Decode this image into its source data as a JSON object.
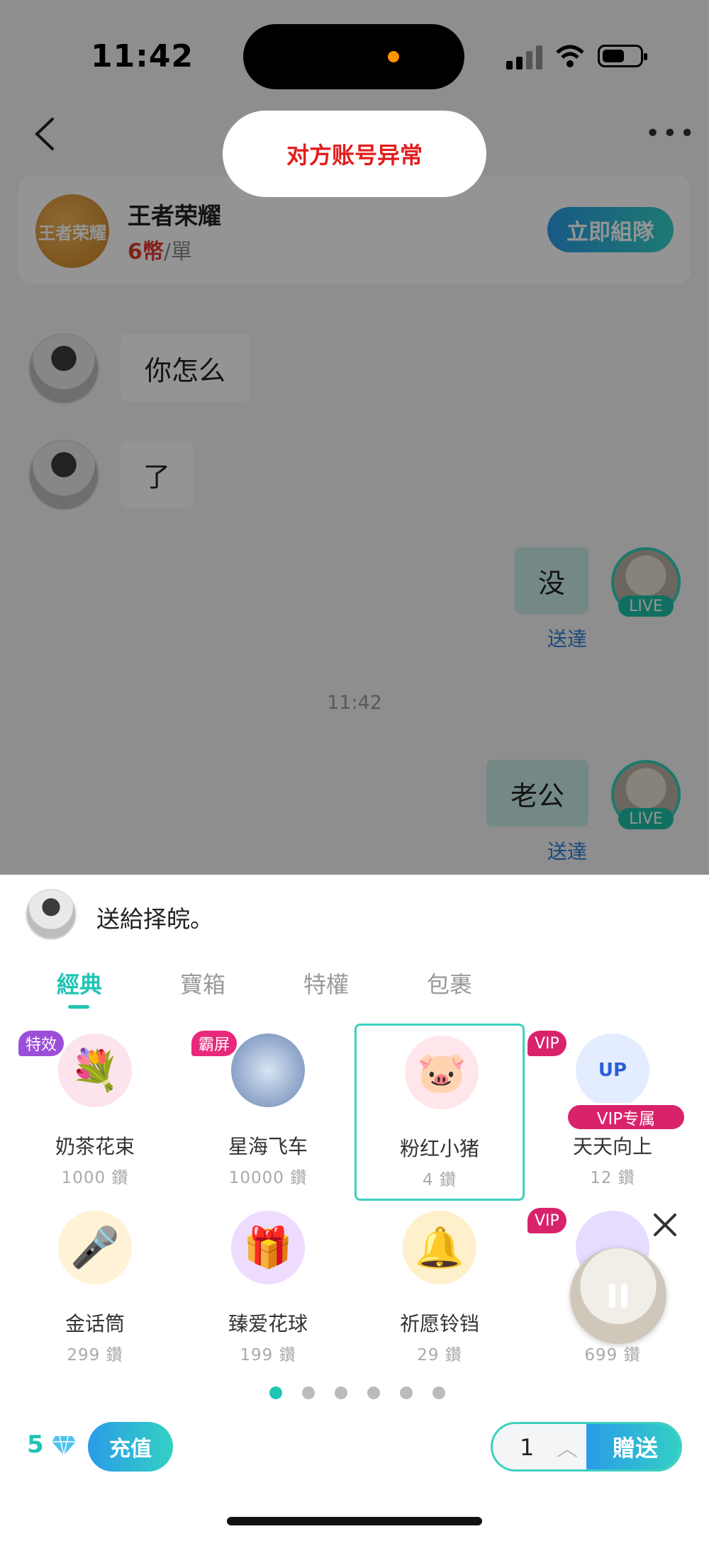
{
  "status_bar": {
    "time": "11:42"
  },
  "toast": {
    "text": "对方账号异常"
  },
  "game_card": {
    "logo_text": "王者荣耀",
    "title": "王者荣耀",
    "price_value": "6",
    "price_unit": "幣",
    "price_sep": "/",
    "price_per": "單",
    "team_button": "立即組隊"
  },
  "messages": [
    {
      "text": "你怎么",
      "from": "other"
    },
    {
      "text": "了",
      "from": "other"
    },
    {
      "text": "没",
      "from": "me",
      "status": "送達"
    },
    {
      "text": "老公",
      "from": "me",
      "status": "送達"
    }
  ],
  "chat_time": "11:42",
  "live_tag": "LIVE",
  "gift_panel": {
    "recipient_text": "送給择皖。",
    "tabs": [
      "經典",
      "寶箱",
      "特權",
      "包裹"
    ],
    "gifts": [
      {
        "name": "奶茶花束",
        "price": "1000 鑽",
        "badge": "特效"
      },
      {
        "name": "星海飞车",
        "price": "10000 鑽",
        "badge": "霸屏"
      },
      {
        "name": "粉红小猪",
        "price": "4 鑽",
        "badge": ""
      },
      {
        "name": "天天向上",
        "price": "12 鑽",
        "badge": "VIP",
        "vip_label": "VIP专属"
      },
      {
        "name": "金话筒",
        "price": "299 鑽",
        "badge": ""
      },
      {
        "name": "臻爱花球",
        "price": "199 鑽",
        "badge": ""
      },
      {
        "name": "祈愿铃铛",
        "price": "29 鑽",
        "badge": ""
      },
      {
        "name": "",
        "price": "699 鑽",
        "badge": "VIP"
      }
    ],
    "balance": "5",
    "recharge_label": "充值",
    "quantity": "1",
    "send_label": "贈送"
  },
  "colors": {
    "accent": "#20c4b4",
    "button_gradient_start": "#2a9be8",
    "toast_text": "#e21d1d",
    "vip": "#d8236b"
  },
  "icons": [
    "back-arrow-icon",
    "more-icon",
    "diamond-icon",
    "chevron-up-icon",
    "close-icon",
    "pause-icon"
  ]
}
